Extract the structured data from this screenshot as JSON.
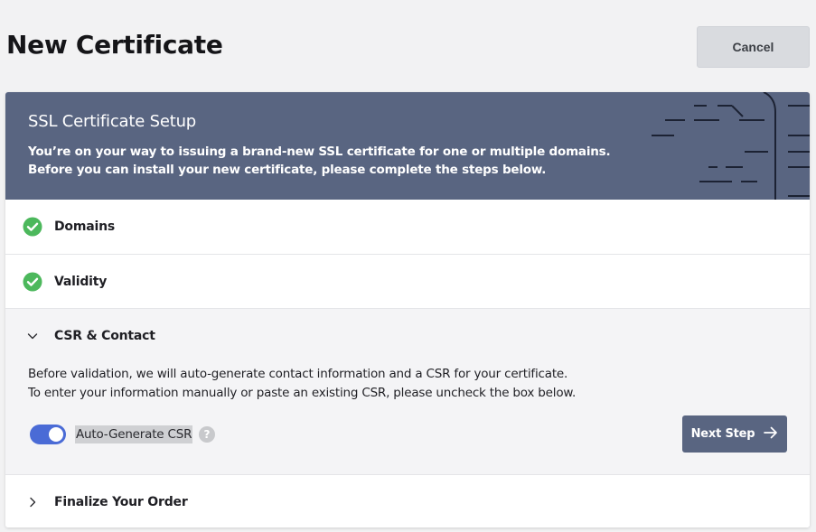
{
  "header": {
    "title": "New Certificate",
    "cancel_label": "Cancel"
  },
  "banner": {
    "title": "SSL Certificate Setup",
    "line1": "You’re on your way to issuing a brand-new SSL certificate for one or multiple domains.",
    "line2": "Before you can install your new certificate, please complete the steps below."
  },
  "steps": [
    {
      "label": "Domains",
      "status": "complete",
      "icon": "check-circle-icon"
    },
    {
      "label": "Validity",
      "status": "complete",
      "icon": "check-circle-icon"
    },
    {
      "label": "CSR & Contact",
      "status": "expanded",
      "icon": "chevron-down-icon"
    },
    {
      "label": "Finalize Your Order",
      "status": "collapsed",
      "icon": "chevron-right-icon"
    }
  ],
  "csr": {
    "desc_line1": "Before validation, we will auto-generate contact information and a CSR for your certificate.",
    "desc_line2": "To enter your information manually or paste an existing CSR, please uncheck the box below.",
    "toggle_label": "Auto-Generate CSR",
    "toggle_on": true,
    "help_symbol": "?",
    "next_label": "Next Step"
  },
  "colors": {
    "accent": "#596581",
    "toggle": "#4a6bd6",
    "success": "#4cb85c"
  }
}
